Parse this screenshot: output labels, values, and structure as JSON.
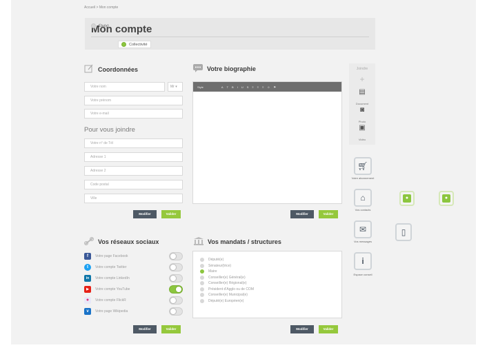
{
  "breadcrumb": "Accueil > Mon compte",
  "header": {
    "title": "Mon compte",
    "options": [
      {
        "label": "Élu(e)",
        "selected": false
      },
      {
        "label": "Collectivité",
        "selected": true
      }
    ]
  },
  "coordonnees": {
    "title": "Coordonnées",
    "fields": {
      "nom": "Votre nom",
      "civilite": "Mr",
      "prenom": "Votre prénom",
      "email": "Votre e-mail"
    },
    "joindre_title": "Pour vous joindre",
    "contact_fields": {
      "tel": "Votre n° de Tél",
      "adresse1": "Adresse 1",
      "adresse2": "Adresse 2",
      "cp": "Code postal",
      "ville": "Ville"
    }
  },
  "biographie": {
    "title": "Votre biographie",
    "toolbar": [
      "Style",
      "A",
      "T",
      "B",
      "I",
      "U",
      "S",
      "≡",
      "≡",
      "≡",
      "☺",
      "⚑"
    ]
  },
  "buttons": {
    "modifier": "Modifier",
    "valider": "Valider"
  },
  "social": {
    "title": "Vos réseaux sociaux",
    "items": [
      {
        "label": "Votre page Facebook",
        "icon": "f",
        "color": "#3b5998",
        "on": false
      },
      {
        "label": "Votre compte Twitter",
        "icon": "t",
        "color": "#1da1f2",
        "on": false
      },
      {
        "label": "Votre compte LinkedIn",
        "icon": "in",
        "color": "#0e76a8",
        "on": false
      },
      {
        "label": "Votre compte YouTube",
        "icon": "▶",
        "color": "#e62117",
        "on": true
      },
      {
        "label": "Votre compte FlickR",
        "icon": "●",
        "color": "#e8e8f8",
        "on": false
      },
      {
        "label": "Votre page Wikipedia",
        "icon": "v",
        "color": "#1a73c8",
        "on": false
      }
    ]
  },
  "mandats": {
    "title": "Vos mandats / structures",
    "items": [
      {
        "label": "Député(e)",
        "on": false
      },
      {
        "label": "Sénateur(trice)",
        "on": false
      },
      {
        "label": "Maire",
        "on": true
      },
      {
        "label": "Conseiller(e) Général(e)",
        "on": false
      },
      {
        "label": "Conseiller(e) Régional(e)",
        "on": false
      },
      {
        "label": "Président d'Agglo ou de COM",
        "on": false
      },
      {
        "label": "Conseiller(e) Municipal(e)",
        "on": false
      },
      {
        "label": "Député(e) Européen(e)",
        "on": false
      }
    ]
  },
  "joindre": {
    "title": "Joindre",
    "items": [
      {
        "label": "Document",
        "icon": "document-icon"
      },
      {
        "label": "Photo",
        "icon": "camera-icon"
      },
      {
        "label": "Vidéo",
        "icon": "video-icon"
      }
    ]
  },
  "side_menu": [
    {
      "label": "Votre abonnement",
      "icon": "cart-icon"
    },
    {
      "label": "Vos contacts",
      "icon": "institution-icon"
    },
    {
      "label": "Vos messages",
      "icon": "chat-icon"
    },
    {
      "label": "Espace conseil",
      "icon": "info-icon"
    }
  ],
  "colors": {
    "accent": "#8cc63f",
    "dark_button": "#4e5965",
    "toggle_on": "#8cc63f"
  }
}
